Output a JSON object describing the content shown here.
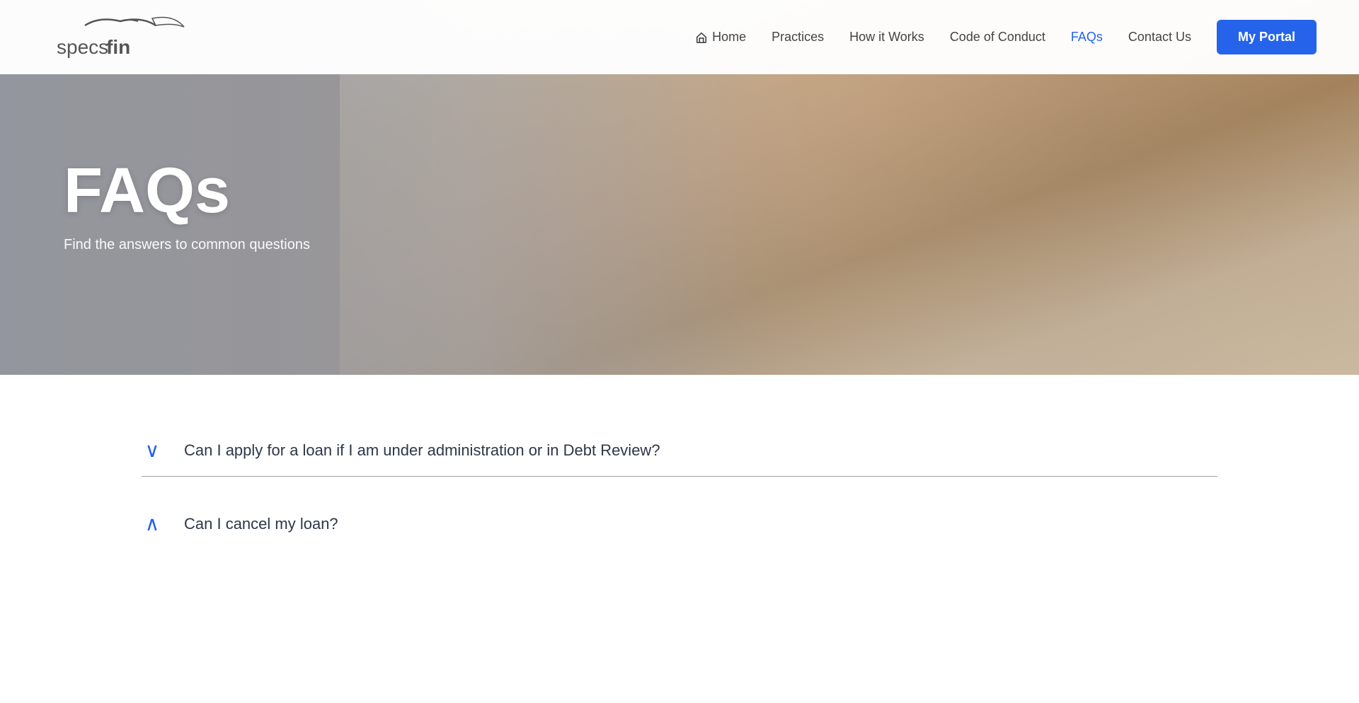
{
  "brand": {
    "name": "specsfin",
    "logo_text": "specsfin"
  },
  "navbar": {
    "links": [
      {
        "id": "home",
        "label": "Home",
        "active": false,
        "has_icon": true
      },
      {
        "id": "practices",
        "label": "Practices",
        "active": false
      },
      {
        "id": "how-it-works",
        "label": "How it Works",
        "active": false
      },
      {
        "id": "code-of-conduct",
        "label": "Code of Conduct",
        "active": false
      },
      {
        "id": "faqs",
        "label": "FAQs",
        "active": true
      },
      {
        "id": "contact-us",
        "label": "Contact Us",
        "active": false
      }
    ],
    "portal_button": "My Portal"
  },
  "hero": {
    "title": "FAQs",
    "subtitle": "Find the answers to common questions"
  },
  "faqs": [
    {
      "id": "faq-1",
      "question": "Can I apply for a loan if I am under administration or in Debt Review?",
      "expanded": false,
      "chevron": "expand",
      "chevron_symbol": "∨"
    },
    {
      "id": "faq-2",
      "question": "Can I cancel my loan?",
      "expanded": true,
      "chevron": "collapse",
      "chevron_symbol": "∧"
    }
  ],
  "colors": {
    "accent_blue": "#2563eb",
    "nav_bg": "#ffffff",
    "hero_text": "#ffffff",
    "body_bg": "#ffffff",
    "faq_text": "#2d3748",
    "divider": "#444444"
  }
}
